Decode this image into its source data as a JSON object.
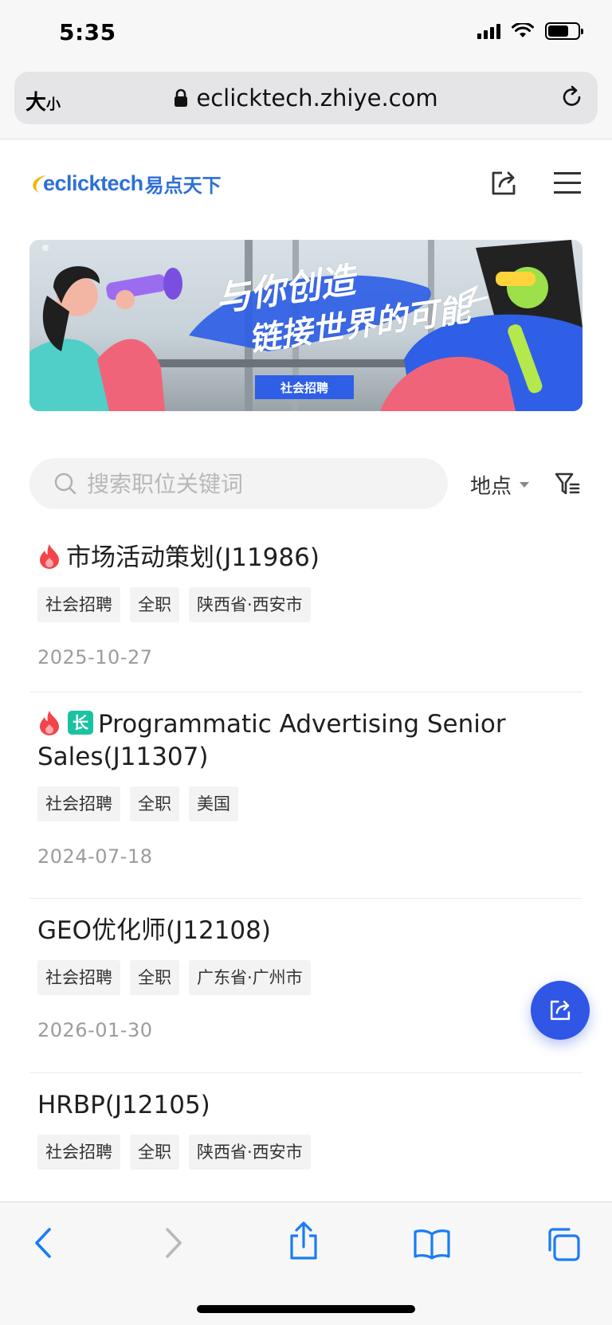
{
  "status_bar": {
    "time": "5:35",
    "battery_level": 0.7
  },
  "browser": {
    "text_size_label": "大",
    "text_size_small": "小",
    "url": "eclicktech.zhiye.com"
  },
  "site": {
    "logo_text": "eclicktech",
    "logo_cn": "易点天下"
  },
  "banner": {
    "headline_line1": "与你创造",
    "headline_line2": "链接世界的可能",
    "tag": "社会招聘"
  },
  "search": {
    "placeholder": "搜索职位关键词",
    "location_label": "地点"
  },
  "jobs": [
    {
      "title": "市场活动策划(J11986)",
      "hot": true,
      "long_term": false,
      "tags": [
        "社会招聘",
        "全职",
        "陕西省·西安市"
      ],
      "date": "2025-10-27"
    },
    {
      "title": "Programmatic Advertising Senior Sales(J11307)",
      "hot": true,
      "long_term": true,
      "long_badge": "长",
      "tags": [
        "社会招聘",
        "全职",
        "美国"
      ],
      "date": "2024-07-18"
    },
    {
      "title": "GEO优化师(J12108)",
      "hot": false,
      "long_term": false,
      "tags": [
        "社会招聘",
        "全职",
        "广东省·广州市"
      ],
      "date": "2026-01-30"
    },
    {
      "title": "HRBP(J12105)",
      "hot": false,
      "long_term": false,
      "tags": [
        "社会招聘",
        "全职",
        "陕西省·西安市"
      ],
      "date": ""
    }
  ],
  "colors": {
    "brand_blue": "#2d6fd8",
    "fab_blue": "#3056e6",
    "hot_red": "#f2454b",
    "long_green": "#19c3a1",
    "ios_blue": "#1a7cf5"
  },
  "icons": [
    "lock-icon",
    "reload-icon",
    "share-icon",
    "menu-icon",
    "search-icon",
    "filter-icon",
    "fire-icon",
    "back-icon",
    "forward-icon",
    "bookmarks-icon",
    "tabs-icon"
  ]
}
